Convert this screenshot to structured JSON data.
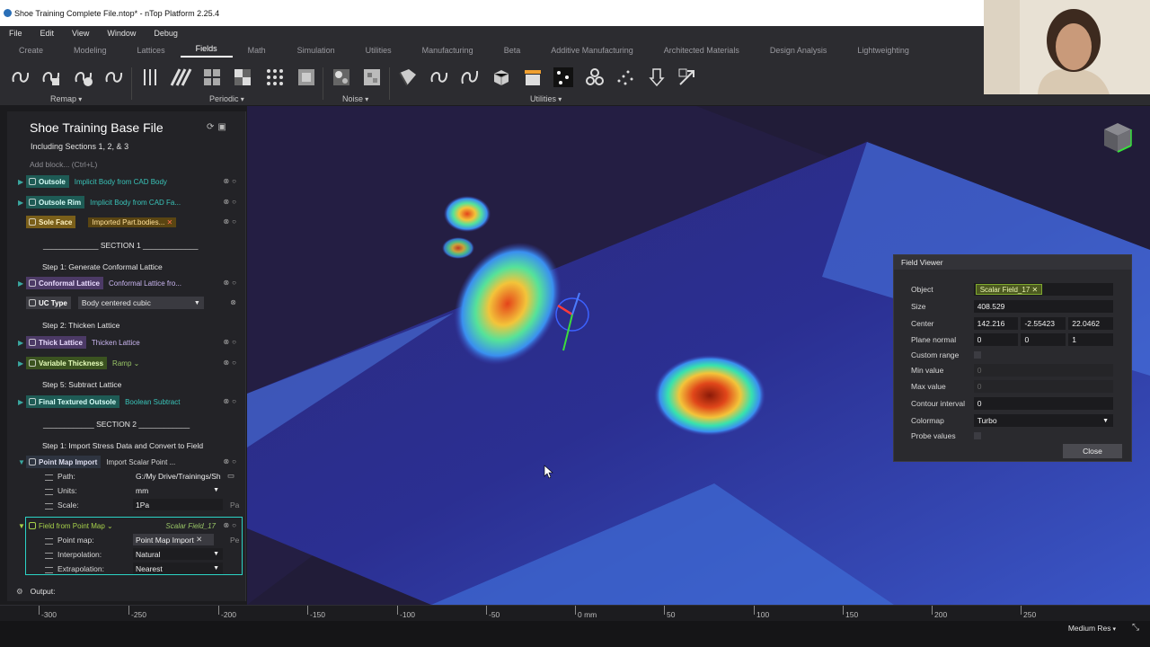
{
  "window": {
    "title": "Shoe Training Complete File.ntop* - nTop Platform 2.25.4"
  },
  "menu": [
    "File",
    "Edit",
    "View",
    "Window",
    "Debug"
  ],
  "tabs": [
    {
      "label": "Create",
      "active": false
    },
    {
      "label": "Modeling",
      "active": false
    },
    {
      "label": "Lattices",
      "active": false
    },
    {
      "label": "Fields",
      "active": true
    },
    {
      "label": "Math",
      "active": false
    },
    {
      "label": "Simulation",
      "active": false
    },
    {
      "label": "Utilities",
      "active": false
    },
    {
      "label": "Manufacturing",
      "active": false
    },
    {
      "label": "Beta",
      "active": false
    },
    {
      "label": "Additive Manufacturing",
      "active": false
    },
    {
      "label": "Architected Materials",
      "active": false
    },
    {
      "label": "Design Analysis",
      "active": false
    },
    {
      "label": "Lightweighting",
      "active": false
    }
  ],
  "toolbar": {
    "groups": [
      "Remap",
      "Periodic",
      "Noise",
      "Utilities"
    ]
  },
  "notebook": {
    "title": "Shoe Training Base File",
    "subtitle": "Including Sections 1, 2, & 3",
    "add_block": "Add block... (Ctrl+L)",
    "blocks": [
      {
        "name": "Outsole",
        "value": "Implicit Body from CAD Body"
      },
      {
        "name": "Outsole Rim",
        "value": "Implicit Body from CAD Fa..."
      },
      {
        "name": "Sole Face",
        "value": "Imported Part.bodies..."
      }
    ],
    "section1": "_____________ SECTION 1 _____________",
    "step1": "Step 1: Generate Conformal Lattice",
    "conformal": {
      "name": "Conformal Lattice",
      "value": "Conformal Lattice fro..."
    },
    "uctype": {
      "name": "UC Type",
      "value": "Body centered cubic"
    },
    "step2": "Step 2: Thicken Lattice",
    "thick": {
      "name": "Thick Lattice",
      "value": "Thicken Lattice"
    },
    "variable": {
      "name": "Variable Thickness",
      "value": "Ramp"
    },
    "step5": "Step 5: Subtract Lattice",
    "final": {
      "name": "Final Textured Outsole",
      "value": "Boolean Subtract"
    },
    "section2": "____________ SECTION 2 ____________",
    "step1b": "Step 1: Import Stress Data and Convert to Field",
    "pointmap": {
      "name": "Point Map Import",
      "value": "Import Scalar Point ..."
    },
    "pm_rows": [
      {
        "label": "Path:",
        "value": "G:/My Drive/Trainings/Sh"
      },
      {
        "label": "Units:",
        "value": "mm"
      },
      {
        "label": "Scale:",
        "value": "1Pa",
        "suffix": "Pa"
      }
    ],
    "ffpm": {
      "name": "Field from Point Map",
      "value": "Scalar Field_17"
    },
    "ffpm_rows": [
      {
        "label": "Point map:",
        "value": "Point Map Import",
        "suffix": "Pe"
      },
      {
        "label": "Interpolation:",
        "value": "Natural"
      },
      {
        "label": "Extrapolation:",
        "value": "Nearest"
      }
    ],
    "output": "Output:"
  },
  "field_viewer": {
    "title": "Field Viewer",
    "object_label": "Object",
    "object": "Scalar Field_17",
    "size_label": "Size",
    "size": "408.529",
    "center_label": "Center",
    "center": [
      "142.216",
      "-2.55423",
      "22.0462"
    ],
    "plane_label": "Plane normal",
    "plane": [
      "0",
      "0",
      "1"
    ],
    "custom_range_label": "Custom range",
    "min_label": "Min value",
    "min": "0",
    "max_label": "Max value",
    "max": "0",
    "contour_label": "Contour interval",
    "contour": "0",
    "colormap_label": "Colormap",
    "colormap": "Turbo",
    "probe_label": "Probe values",
    "close": "Close"
  },
  "ruler": {
    "labels": [
      "-300",
      "-250",
      "-200",
      "-150",
      "-100",
      "-50",
      "0 mm",
      "50",
      "100",
      "150",
      "200",
      "250"
    ]
  },
  "status": {
    "resolution": "Medium Res"
  }
}
